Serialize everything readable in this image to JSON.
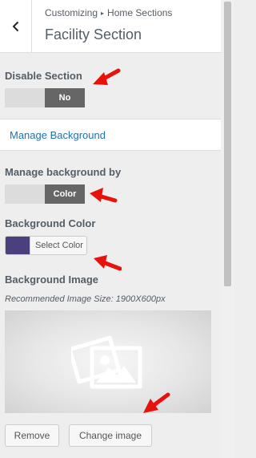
{
  "header": {
    "breadcrumb_parent": "Customizing",
    "breadcrumb_separator": "▸",
    "breadcrumb_current": "Home Sections",
    "title": "Facility Section",
    "back_icon": "chevron-left-icon"
  },
  "disable_section": {
    "label": "Disable Section",
    "toggle_value": "No"
  },
  "manage_background_link": "Manage Background",
  "manage_background_by": {
    "label": "Manage background by",
    "toggle_value": "Color"
  },
  "background_color": {
    "label": "Background Color",
    "button_label": "Select Color",
    "swatch_color": "#4b3f7e"
  },
  "background_image": {
    "label": "Background Image",
    "hint": "Recommended Image Size: 1900X600px",
    "placeholder_icon": "image-placeholder-icon",
    "remove_label": "Remove",
    "change_label": "Change image"
  },
  "annotation_color": "#e8120c"
}
